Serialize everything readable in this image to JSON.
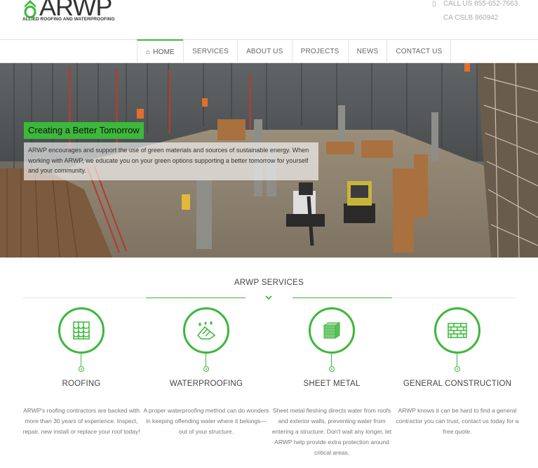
{
  "brand": {
    "name": "ARWP",
    "tagline": "ALLIED ROOFING AND WATERPROOFING",
    "accent": "#3cb83a"
  },
  "contact": {
    "phone": "CALL US 855-652-7663",
    "license": "CA CSLB 860942"
  },
  "nav": {
    "items": [
      {
        "label": "HOME",
        "icon": "home-icon",
        "active": true
      },
      {
        "label": "SERVICES"
      },
      {
        "label": "ABOUT US"
      },
      {
        "label": "PROJECTS"
      },
      {
        "label": "NEWS"
      },
      {
        "label": "CONTACT US"
      }
    ]
  },
  "hero": {
    "title": "Creating a Better Tomorrow",
    "text": "ARWP encourages and support the use of green materials and sources of sustainable energy. When working with ARWP, we educate you on your green options supporting a better tomorrow for yourself and your community."
  },
  "services": {
    "title": "ARWP SERVICES",
    "items": [
      {
        "name": "ROOFING",
        "icon": "roof-tiles-icon",
        "desc": "ARWP's roofing contractors are backed with more than 30 years of experience. Inspect, repair, new install or replace your roof today!"
      },
      {
        "name": "WATERPROOFING",
        "icon": "waterproof-roof-icon",
        "desc": "A proper waterproofing method can do wonders in keeping offending water where it belongs—out of your structure."
      },
      {
        "name": "SHEET METAL",
        "icon": "sheet-metal-icon",
        "desc": "Sheet metal fleshing directs water from roofs and exterior walls, preventing water from entering a structure. Don't wait any longer, let ARWP help provide extra protection around critical areas."
      },
      {
        "name": "GENERAL CONSTRUCTION",
        "icon": "brick-wall-icon",
        "desc": "ARWP knows it can be hard to find a general contractor you can trust, contact us today for a free quote."
      }
    ]
  }
}
